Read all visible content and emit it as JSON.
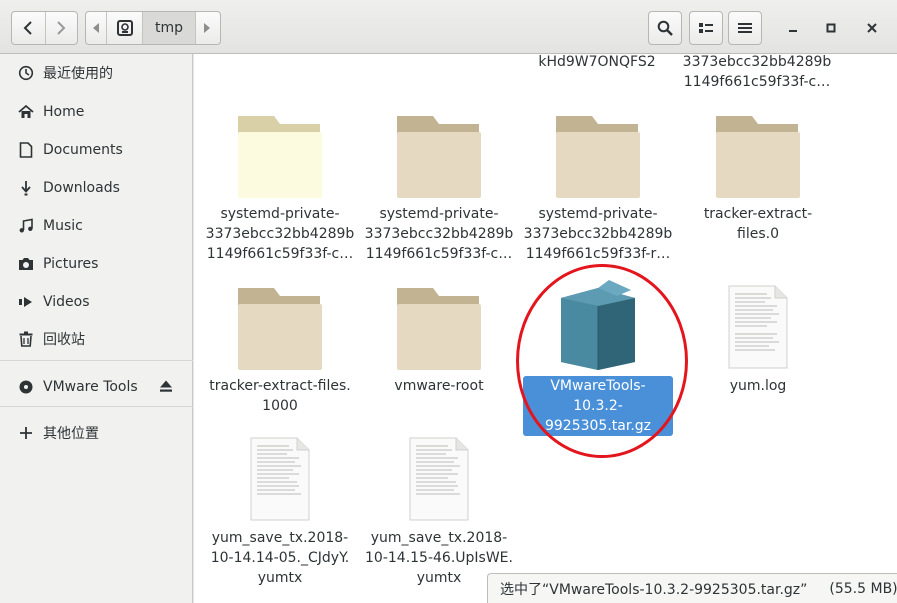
{
  "header": {
    "path_segment": "tmp",
    "icons": [
      "back-icon",
      "forward-icon",
      "path-left-icon",
      "drive-icon",
      "path-right-icon",
      "search-icon",
      "list-view-icon",
      "menu-icon",
      "minimize-icon",
      "maximize-icon",
      "close-icon"
    ]
  },
  "sidebar": {
    "items": [
      {
        "label": "最近使用的",
        "icon": "recent-icon"
      },
      {
        "label": "Home",
        "icon": "home-icon"
      },
      {
        "label": "Documents",
        "icon": "documents-icon"
      },
      {
        "label": "Downloads",
        "icon": "downloads-icon"
      },
      {
        "label": "Music",
        "icon": "music-icon"
      },
      {
        "label": "Pictures",
        "icon": "pictures-icon"
      },
      {
        "label": "Videos",
        "icon": "videos-icon"
      },
      {
        "label": "回收站",
        "icon": "trash-icon"
      }
    ],
    "device": {
      "label": "VMware Tools",
      "icon": "disc-icon"
    },
    "other": {
      "label": "其他位置",
      "icon": "plus-icon"
    }
  },
  "files": {
    "row0": [
      {
        "line1": "kHd9W7ONQFS2"
      },
      {
        "line1": "3373ebcc32bb4289b",
        "line2": "1149f661c59f33f-c…"
      }
    ],
    "row1": [
      {
        "line1": "systemd-private-",
        "line2": "3373ebcc32bb4289b",
        "line3": "1149f661c59f33f-c…",
        "type": "folder-light"
      },
      {
        "line1": "systemd-private-",
        "line2": "3373ebcc32bb4289b",
        "line3": "1149f661c59f33f-c…",
        "type": "folder"
      },
      {
        "line1": "systemd-private-",
        "line2": "3373ebcc32bb4289b",
        "line3": "1149f661c59f33f-r…",
        "type": "folder"
      },
      {
        "line1": "tracker-extract-files.0",
        "type": "folder"
      }
    ],
    "row2": [
      {
        "line1": "tracker-extract-files.",
        "line2": "1000",
        "type": "folder"
      },
      {
        "line1": "vmware-root",
        "type": "folder"
      },
      {
        "line1": "VMwareTools-10.3.2-",
        "line2": "9925305.tar.gz",
        "type": "package",
        "selected": true
      },
      {
        "line1": "yum.log",
        "type": "text"
      }
    ],
    "row3": [
      {
        "line1": "yum_save_tx.2018-",
        "line2": "10-14.14-05._CJdyY.",
        "line3": "yumtx",
        "type": "text"
      },
      {
        "line1": "yum_save_tx.2018-",
        "line2": "10-14.15-46.UpIsWE.",
        "line3": "yumtx",
        "type": "text"
      }
    ]
  },
  "status": {
    "selected_text": "选中了“VMwareTools-10.3.2-9925305.tar.gz”",
    "size_text": "(55.5 MB)"
  },
  "colors": {
    "selection": "#4a90d9",
    "annotation_circle": "#e3161e",
    "folder": "#e0d3bd",
    "folder_tab": "#c9b99b"
  }
}
